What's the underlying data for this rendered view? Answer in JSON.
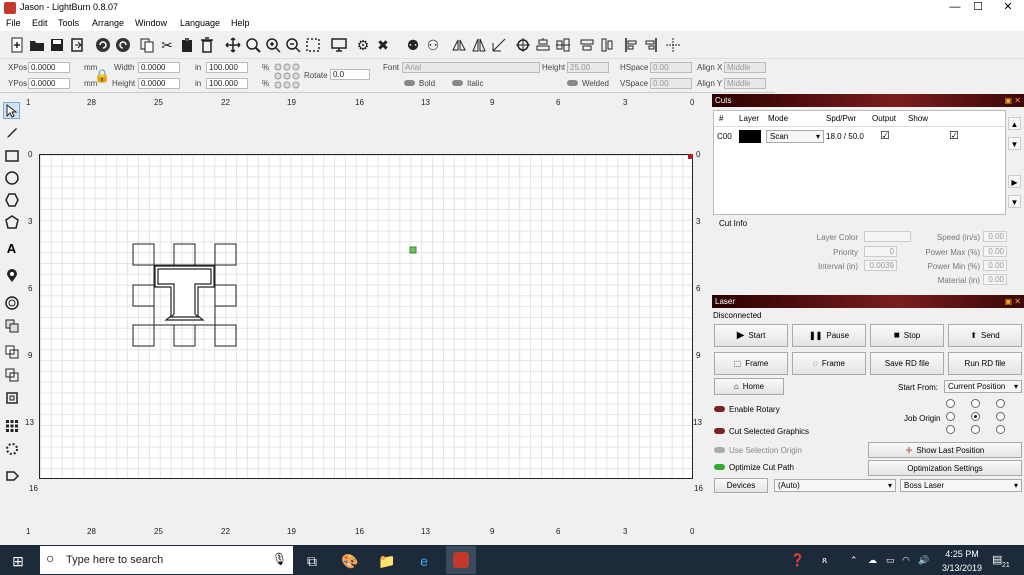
{
  "window": {
    "title": "Jason - LightBurn 0.8.07",
    "minimize": "—",
    "maximize": "☐",
    "close": "✕"
  },
  "menu": [
    "File",
    "Edit",
    "Tools",
    "Arrange",
    "Window",
    "Language",
    "Help"
  ],
  "props": {
    "xpos_label": "XPos",
    "xpos": "0.0000",
    "ypos_label": "YPos",
    "ypos": "0.0000",
    "mm_label": "mm",
    "width_label": "Width",
    "width": "0.0000",
    "height_label": "Height",
    "height": "0.0000",
    "in_label": "in",
    "w_pct": "100.000",
    "h_pct": "100.000",
    "pct_label": "%",
    "rotate_label": "Rotate",
    "rotate": "0.0",
    "font_label": "Font",
    "font": "Arial",
    "font_height_label": "Height",
    "font_height": "25.00",
    "hspace_label": "HSpace",
    "hspace": "0.00",
    "vspace_label": "VSpace",
    "vspace": "0.00",
    "alignx_label": "Align X",
    "alignx": "Middle",
    "aligny_label": "Align Y",
    "aligny": "Middle",
    "bold_label": "Bold",
    "italic_label": "Italic",
    "welded_label": "Welded"
  },
  "rulers": {
    "top": [
      "1",
      "28",
      "25",
      "22",
      "19",
      "16",
      "13",
      "9",
      "6",
      "3",
      "0"
    ],
    "bottom": [
      "1",
      "28",
      "25",
      "22",
      "19",
      "16",
      "13",
      "9",
      "6",
      "3",
      "0"
    ],
    "left": [
      "0",
      "3",
      "6",
      "9",
      "13",
      "16"
    ],
    "right": [
      "0",
      "3",
      "6",
      "9",
      "13",
      "16"
    ]
  },
  "cuts": {
    "panel_title": "Cuts",
    "headers": {
      "num": "#",
      "layer": "Layer",
      "mode": "Mode",
      "spdpwr": "Spd/Pwr",
      "output": "Output",
      "show": "Show"
    },
    "row": {
      "num": "C00",
      "layer_color": "#000000",
      "mode": "Scan",
      "spdpwr": "18.0 / 50.0",
      "output_check": "☑",
      "show_check": "☑"
    },
    "side_buttons": [
      "▲",
      "▼",
      "▶",
      "▼"
    ],
    "cutinfo_title": "Cut Info",
    "layer_color_label": "Layer Color",
    "priority_label": "Priority",
    "priority": "0",
    "interval_label": "Interval (in)",
    "interval": "0.0039",
    "speed_label": "Speed (in/s)",
    "speed": "0.00",
    "pmax_label": "Power Max (%)",
    "pmax": "0.00",
    "pmin_label": "Power Min (%)",
    "pmin": "0.00",
    "material_label": "Material (in)",
    "material": "0.00"
  },
  "laser": {
    "panel_title": "Laser",
    "status": "Disconnected",
    "start": "Start",
    "pause": "Pause",
    "stop": "Stop",
    "send": "Send",
    "frame1": "Frame",
    "frame2": "Frame",
    "save_rd": "Save RD file",
    "run_rd": "Run RD file",
    "home": "Home",
    "start_from_label": "Start From:",
    "start_from": "Current Position",
    "enable_rotary": "Enable Rotary",
    "job_origin_label": "Job Origin",
    "cut_selected": "Cut Selected Graphics",
    "use_selection_origin": "Use Selection Origin",
    "show_last_position": "Show Last Position",
    "optimize_cut_path": "Optimize Cut Path",
    "optimization_settings": "Optimization Settings",
    "devices": "Devices",
    "device_port": "(Auto)",
    "device_name": "Boss Laser",
    "job_origin_selected": 4
  },
  "taskbar": {
    "search_placeholder": "Type here to search",
    "time": "4:25 PM",
    "date": "3/13/2019",
    "notifications": "21"
  },
  "colors": {
    "panel_red": "#7a1d1d",
    "accent": "#f5a623",
    "taskbar": "#1c2a3a"
  }
}
